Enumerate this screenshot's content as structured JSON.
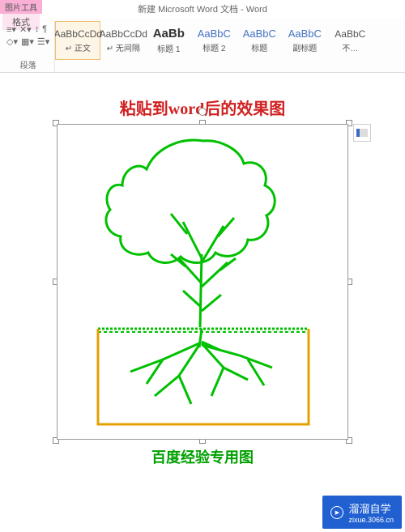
{
  "title": "新建 Microsoft Word 文档 - Word",
  "context_tab": {
    "top": "图片工具",
    "bottom": "格式"
  },
  "paragraph": {
    "label": "段落"
  },
  "styles": [
    {
      "preview": "AaBbCcDd",
      "name": "↵ 正文",
      "cls": "small",
      "selected": true
    },
    {
      "preview": "AaBbCcDd",
      "name": "↵ 无间隔",
      "cls": "small"
    },
    {
      "preview": "AaBb",
      "name": "标题 1",
      "cls": "big"
    },
    {
      "preview": "AaBbC",
      "name": "标题 2",
      "cls": "med"
    },
    {
      "preview": "AaBbC",
      "name": "标题",
      "cls": "med"
    },
    {
      "preview": "AaBbC",
      "name": "副标题",
      "cls": "med"
    },
    {
      "preview": "AaBbC",
      "name": "不…",
      "cls": "small"
    }
  ],
  "doc": {
    "heading": "粘贴到word后的效果图",
    "caption": "百度经验专用图"
  },
  "watermark": {
    "text": "溜溜自学",
    "url": "zixue.3066.cn"
  }
}
